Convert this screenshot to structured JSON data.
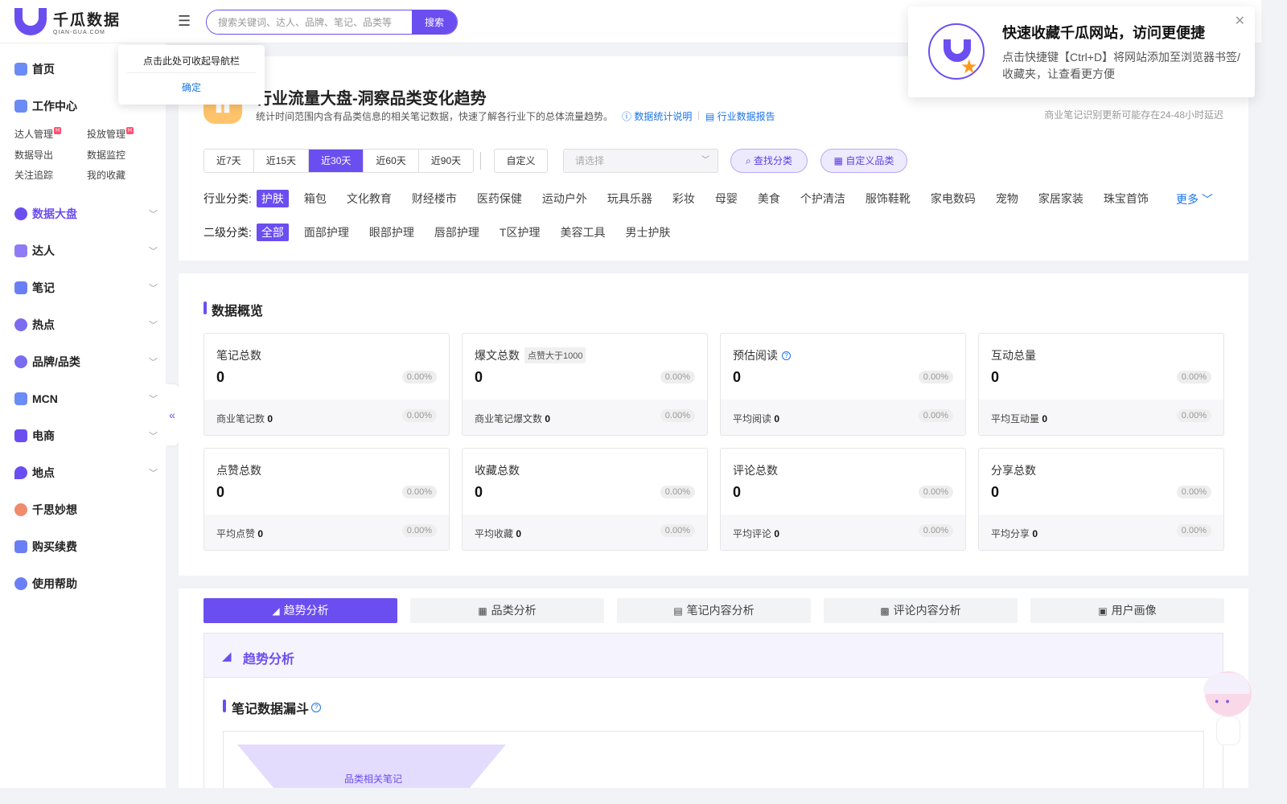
{
  "brand": {
    "name_cn": "千瓜数据",
    "name_en": "QIAN-GUA.COM"
  },
  "search": {
    "placeholder": "搜索关键词、达人、品牌、笔记、品类等",
    "button": "搜索"
  },
  "tooltip": {
    "text": "点击此处可收起导航栏",
    "confirm": "确定"
  },
  "sidebar": {
    "items": [
      {
        "label": "首页",
        "icon": "home-icon",
        "color": "#6b8cf5"
      },
      {
        "label": "工作中心",
        "icon": "workbench-icon",
        "color": "#6b8cf5"
      },
      {
        "label": "数据大盘",
        "icon": "pie-chart-icon",
        "color": "#6b4ef0"
      },
      {
        "label": "达人",
        "icon": "user-icon",
        "color": "#8f7cf5"
      },
      {
        "label": "笔记",
        "icon": "notebook-icon",
        "color": "#6b7ff5"
      },
      {
        "label": "热点",
        "icon": "flame-icon",
        "color": "#7b6cf0"
      },
      {
        "label": "品牌/品类",
        "icon": "brand-icon",
        "color": "#7a6cf0"
      },
      {
        "label": "MCN",
        "icon": "mcn-icon",
        "color": "#6b8cf5"
      },
      {
        "label": "电商",
        "icon": "wallet-icon",
        "color": "#6b4ef0"
      },
      {
        "label": "地点",
        "icon": "location-pin-icon",
        "color": "#6b4ef0"
      },
      {
        "label": "千思妙想",
        "icon": "bulb-icon",
        "color": "#f08b6c"
      },
      {
        "label": "购买续费",
        "icon": "cart-icon",
        "color": "#6b7ff5"
      },
      {
        "label": "使用帮助",
        "icon": "help-icon",
        "color": "#6b7ff5"
      }
    ],
    "work_sub": [
      "达人管理",
      "投放管理",
      "数据导出",
      "数据监控",
      "关注追踪",
      "我的收藏"
    ],
    "hot_badge": "H",
    "collapse": "«"
  },
  "header": {
    "title": "行业流量大盘-洞察品类变化趋势",
    "desc": "统计时间范围内含有品类信息的相关笔记数据，快速了解各行业下的总体流量趋势。",
    "link1": "数据统计说明",
    "link2": "行业数据报告",
    "delay_note": "商业笔记识别更新可能存在24-48小时延迟"
  },
  "filters": {
    "ranges": [
      "近7天",
      "近15天",
      "近30天",
      "近60天",
      "近90天"
    ],
    "active_range": 2,
    "custom": "自定义",
    "select_placeholder": "请选择",
    "find_category": "查找分类",
    "custom_category": "自定义品类",
    "industry_label": "行业分类:",
    "industries": [
      "护肤",
      "箱包",
      "文化教育",
      "财经楼市",
      "医药保健",
      "运动户外",
      "玩具乐器",
      "彩妆",
      "母婴",
      "美食",
      "个护清洁",
      "服饰鞋靴",
      "家电数码",
      "宠物",
      "家居家装",
      "珠宝首饰"
    ],
    "more": "更多",
    "secondary_label": "二级分类:",
    "secondary": [
      "全部",
      "面部护理",
      "眼部护理",
      "唇部护理",
      "T区护理",
      "美容工具",
      "男士护肤"
    ]
  },
  "overview": {
    "title": "数据概览",
    "cards": [
      {
        "name": "笔记总数",
        "value": "0",
        "pct": "0.00%",
        "sub": "商业笔记数",
        "sub_value": "0",
        "sub_pct": "0.00%"
      },
      {
        "name": "爆文总数",
        "tag": "点赞大于1000",
        "value": "0",
        "pct": "0.00%",
        "sub": "商业笔记爆文数",
        "sub_value": "0",
        "sub_pct": "0.00%"
      },
      {
        "name": "预估阅读",
        "value": "0",
        "pct": "0.00%",
        "sub": "平均阅读",
        "sub_value": "0",
        "sub_pct": "0.00%"
      },
      {
        "name": "互动总量",
        "value": "0",
        "pct": "0.00%",
        "sub": "平均互动量",
        "sub_value": "0",
        "sub_pct": "0.00%"
      },
      {
        "name": "点赞总数",
        "value": "0",
        "pct": "0.00%",
        "sub": "平均点赞",
        "sub_value": "0",
        "sub_pct": "0.00%"
      },
      {
        "name": "收藏总数",
        "value": "0",
        "pct": "0.00%",
        "sub": "平均收藏",
        "sub_value": "0",
        "sub_pct": "0.00%"
      },
      {
        "name": "评论总数",
        "value": "0",
        "pct": "0.00%",
        "sub": "平均评论",
        "sub_value": "0",
        "sub_pct": "0.00%"
      },
      {
        "name": "分享总数",
        "value": "0",
        "pct": "0.00%",
        "sub": "平均分享",
        "sub_value": "0",
        "sub_pct": "0.00%"
      }
    ]
  },
  "analysis": {
    "tabs": [
      "趋势分析",
      "品类分析",
      "笔记内容分析",
      "评论内容分析",
      "用户画像"
    ],
    "section_title": "趋势分析",
    "funnel_title": "笔记数据漏斗",
    "funnel_label": "品类相关笔记"
  },
  "popup": {
    "title": "快速收藏千瓜网站，访问更便捷",
    "text": "点击快捷键【Ctrl+D】将网站添加至浏览器书签/收藏夹，让查看更方便"
  }
}
